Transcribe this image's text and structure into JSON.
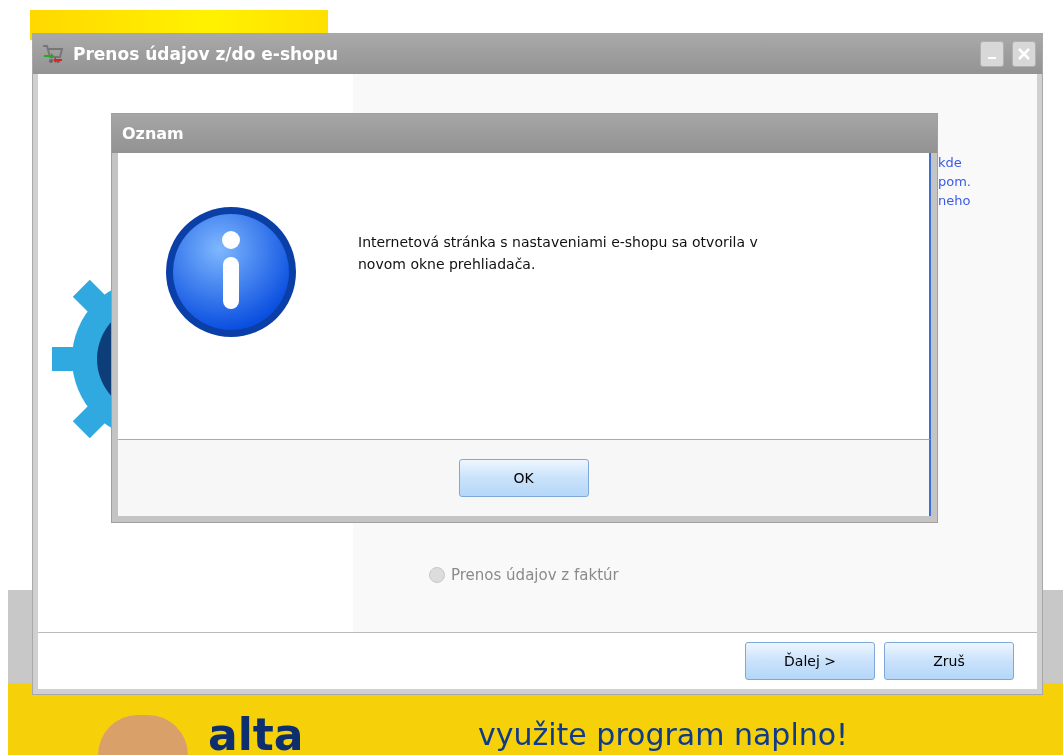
{
  "background": {
    "banner": {
      "logo": "alta",
      "slogan": "využite program naplno!"
    }
  },
  "window": {
    "title": "Prenos údajov z/do e-shopu",
    "options": [
      {
        "label": "Prenos údajov z faktúr",
        "selected": false,
        "disabled": true
      }
    ],
    "link_fragments": [
      "kde",
      "pom.",
      "neho"
    ],
    "buttons": [
      {
        "label": "Ďalej >"
      },
      {
        "label": "Zruš"
      }
    ]
  },
  "dialog": {
    "title": "Oznam",
    "message": "Internetová stránka s nastaveniami e-shopu sa otvorila v novom okne prehliadača.",
    "buttons": [
      {
        "label": "OK"
      }
    ]
  }
}
